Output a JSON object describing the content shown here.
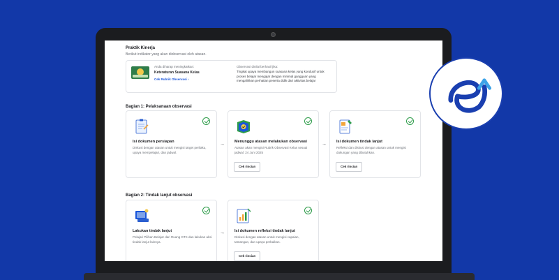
{
  "header": {
    "title": "Praktik Kinerja",
    "subtitle": "Berikut indikator yang akan diobservasi oleh atasan."
  },
  "info_box": {
    "prompt": "Anda diharap meningkatkan:",
    "indicator": "Keteraturan Suasana Kelas",
    "link": "Cek Rubrik Observasi",
    "link_arrow": "›",
    "criteria_label": "Observasi dinilai berhasil jika:",
    "criteria_text": "Tingkat upaya membangun suasana kelas yang kondusif untuk proses belajar mengajar dengan minimal gangguan yang mengalihkan perhatian peserta didik dari aktivitas belajar"
  },
  "section1": {
    "title": "Bagian 1: Pelaksanaan observasi",
    "cards": [
      {
        "title": "Isi dokumen persiapan",
        "desc": "Diskusi dengan atasan untuk mengisi target perilaku, upaya mempelajari, dan jadwal."
      },
      {
        "title": "Menunggu atasan melakukan observasi",
        "desc": "Atasan akan mengisi Rubrik Observasi Kelas sesuai jadwal: 24 Juni 2025",
        "button": "Cek rincian"
      },
      {
        "title": "Isi dokumen tindak lanjut",
        "desc": "Refleksi dan diskusi dengan atasan untuk mengisi dukungan yang dibutuhkan.",
        "button": "Cek rincian"
      }
    ]
  },
  "section2": {
    "title": "Bagian 2: Tindak lanjut observasi",
    "cards": [
      {
        "title": "Lakukan tindak lanjut",
        "desc": "Pelajari Pilihan Belajar dari Ruang GTK dan lakukan aksi tindak lanjut lainnya."
      },
      {
        "title": "Isi dokumen refleksi tindak lanjut",
        "desc": "Diskusi dengan atasan untuk mengisi capaian, tantangan, dan upaya perbaikan.",
        "button": "Cek rincian"
      }
    ]
  },
  "arrow_glyph": "→",
  "colors": {
    "background": "#1238a8",
    "accent": "#1a56db",
    "success": "#2e9c4a"
  }
}
